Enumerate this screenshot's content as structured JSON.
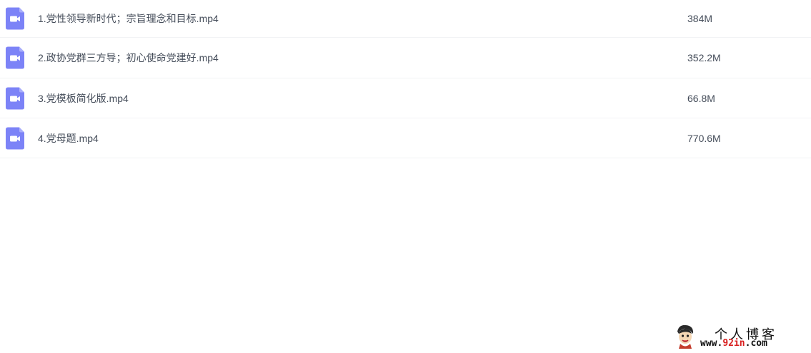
{
  "colors": {
    "video_icon_bg": "#7c83f7",
    "text": "#454d5a",
    "row_divider": "#f2f3f5",
    "watermark_highlight": "#d81e1e"
  },
  "file_list": [
    {
      "icon": "video-file-icon",
      "name": "1.党性领导新时代；宗旨理念和目标.mp4",
      "size": "384M"
    },
    {
      "icon": "video-file-icon",
      "name": "2.政协党群三方导；初心使命党建好.mp4",
      "size": "352.2M"
    },
    {
      "icon": "video-file-icon",
      "name": "3.党模板简化版.mp4",
      "size": "66.8M"
    },
    {
      "icon": "video-file-icon",
      "name": "4.党母题.mp4",
      "size": "770.6M"
    }
  ],
  "watermark": {
    "title": "个人博客",
    "url_prefix": "www.",
    "url_highlight": "92in",
    "url_suffix": ".com"
  }
}
